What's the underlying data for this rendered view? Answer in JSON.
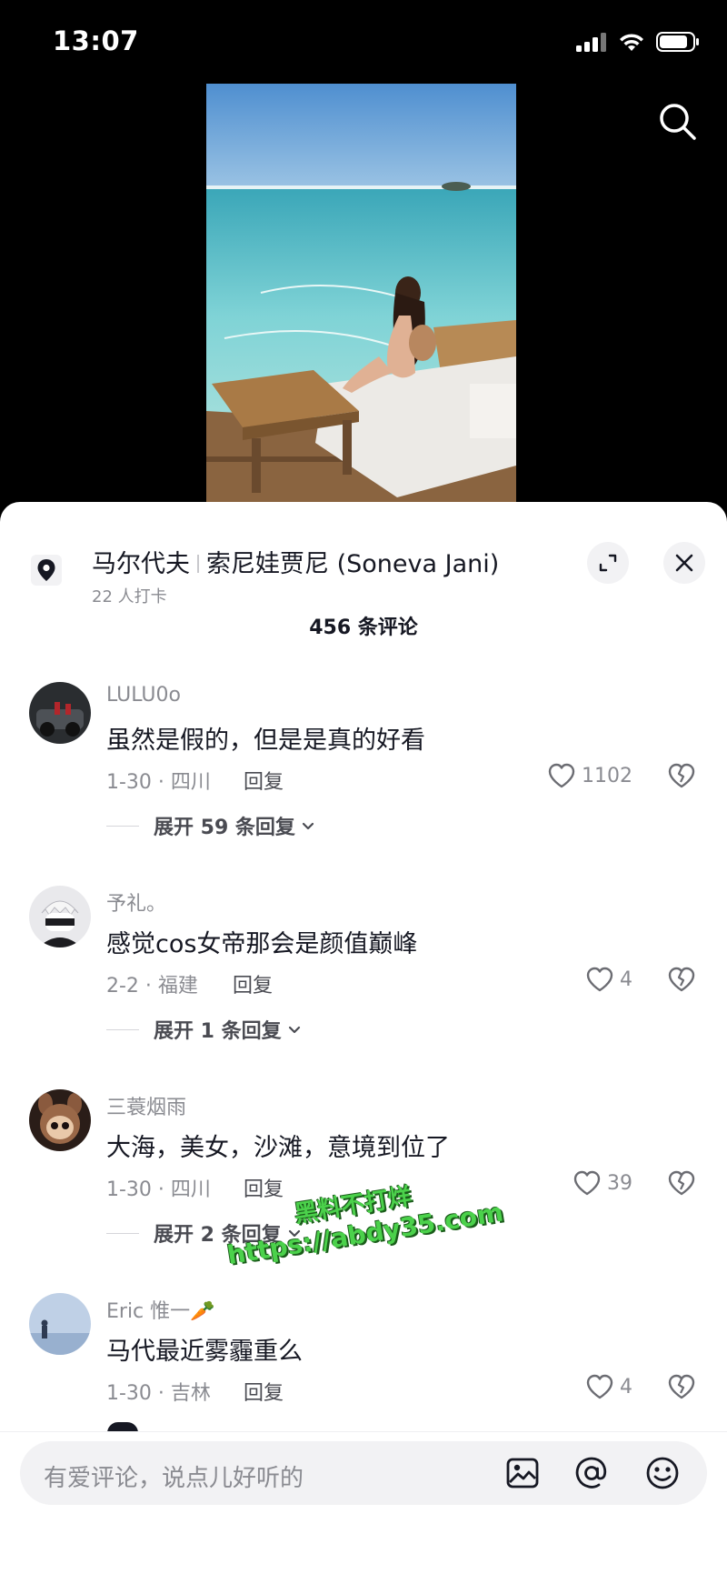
{
  "status_bar": {
    "time": "13:07"
  },
  "location": {
    "title_part1": "马尔代夫",
    "title_part2": "索尼娃贾尼 (Soneva Jani)",
    "checkins": "22 人打卡"
  },
  "comment_count": "456 条评论",
  "comments": [
    {
      "user": "LULU0o",
      "text": "虽然是假的，但是是真的好看",
      "meta": "1-30 · 四川",
      "reply": "回复",
      "likes": "1102",
      "expand": "展开 59 条回复"
    },
    {
      "user": "予礼。",
      "text": "感觉cos女帝那会是颜值巅峰",
      "meta": "2-2 · 福建",
      "reply": "回复",
      "likes": "4",
      "expand": "展开 1 条回复"
    },
    {
      "user": "三蓑烟雨",
      "text": "大海，美女，沙滩，意境到位了",
      "meta": "1-30 · 四川",
      "reply": "回复",
      "likes": "39",
      "expand": "展开 2 条回复"
    },
    {
      "user": "Eric 惟一🥕",
      "text": "马代最近雾霾重么",
      "meta": "1-30 · 吉林",
      "reply": "回复",
      "likes": "4",
      "expand": ""
    }
  ],
  "watermark": {
    "line1": "黑料不打烊",
    "line2": "https://abdy35.com"
  },
  "input": {
    "placeholder": "有爱评论，说点儿好听的"
  },
  "icons": [
    "signal-icon",
    "wifi-icon",
    "battery-icon",
    "search-icon",
    "location-pin-icon",
    "expand-icon",
    "close-icon",
    "heart-icon",
    "broken-heart-icon",
    "chevron-down-icon",
    "image-icon",
    "at-icon",
    "emoji-icon"
  ]
}
